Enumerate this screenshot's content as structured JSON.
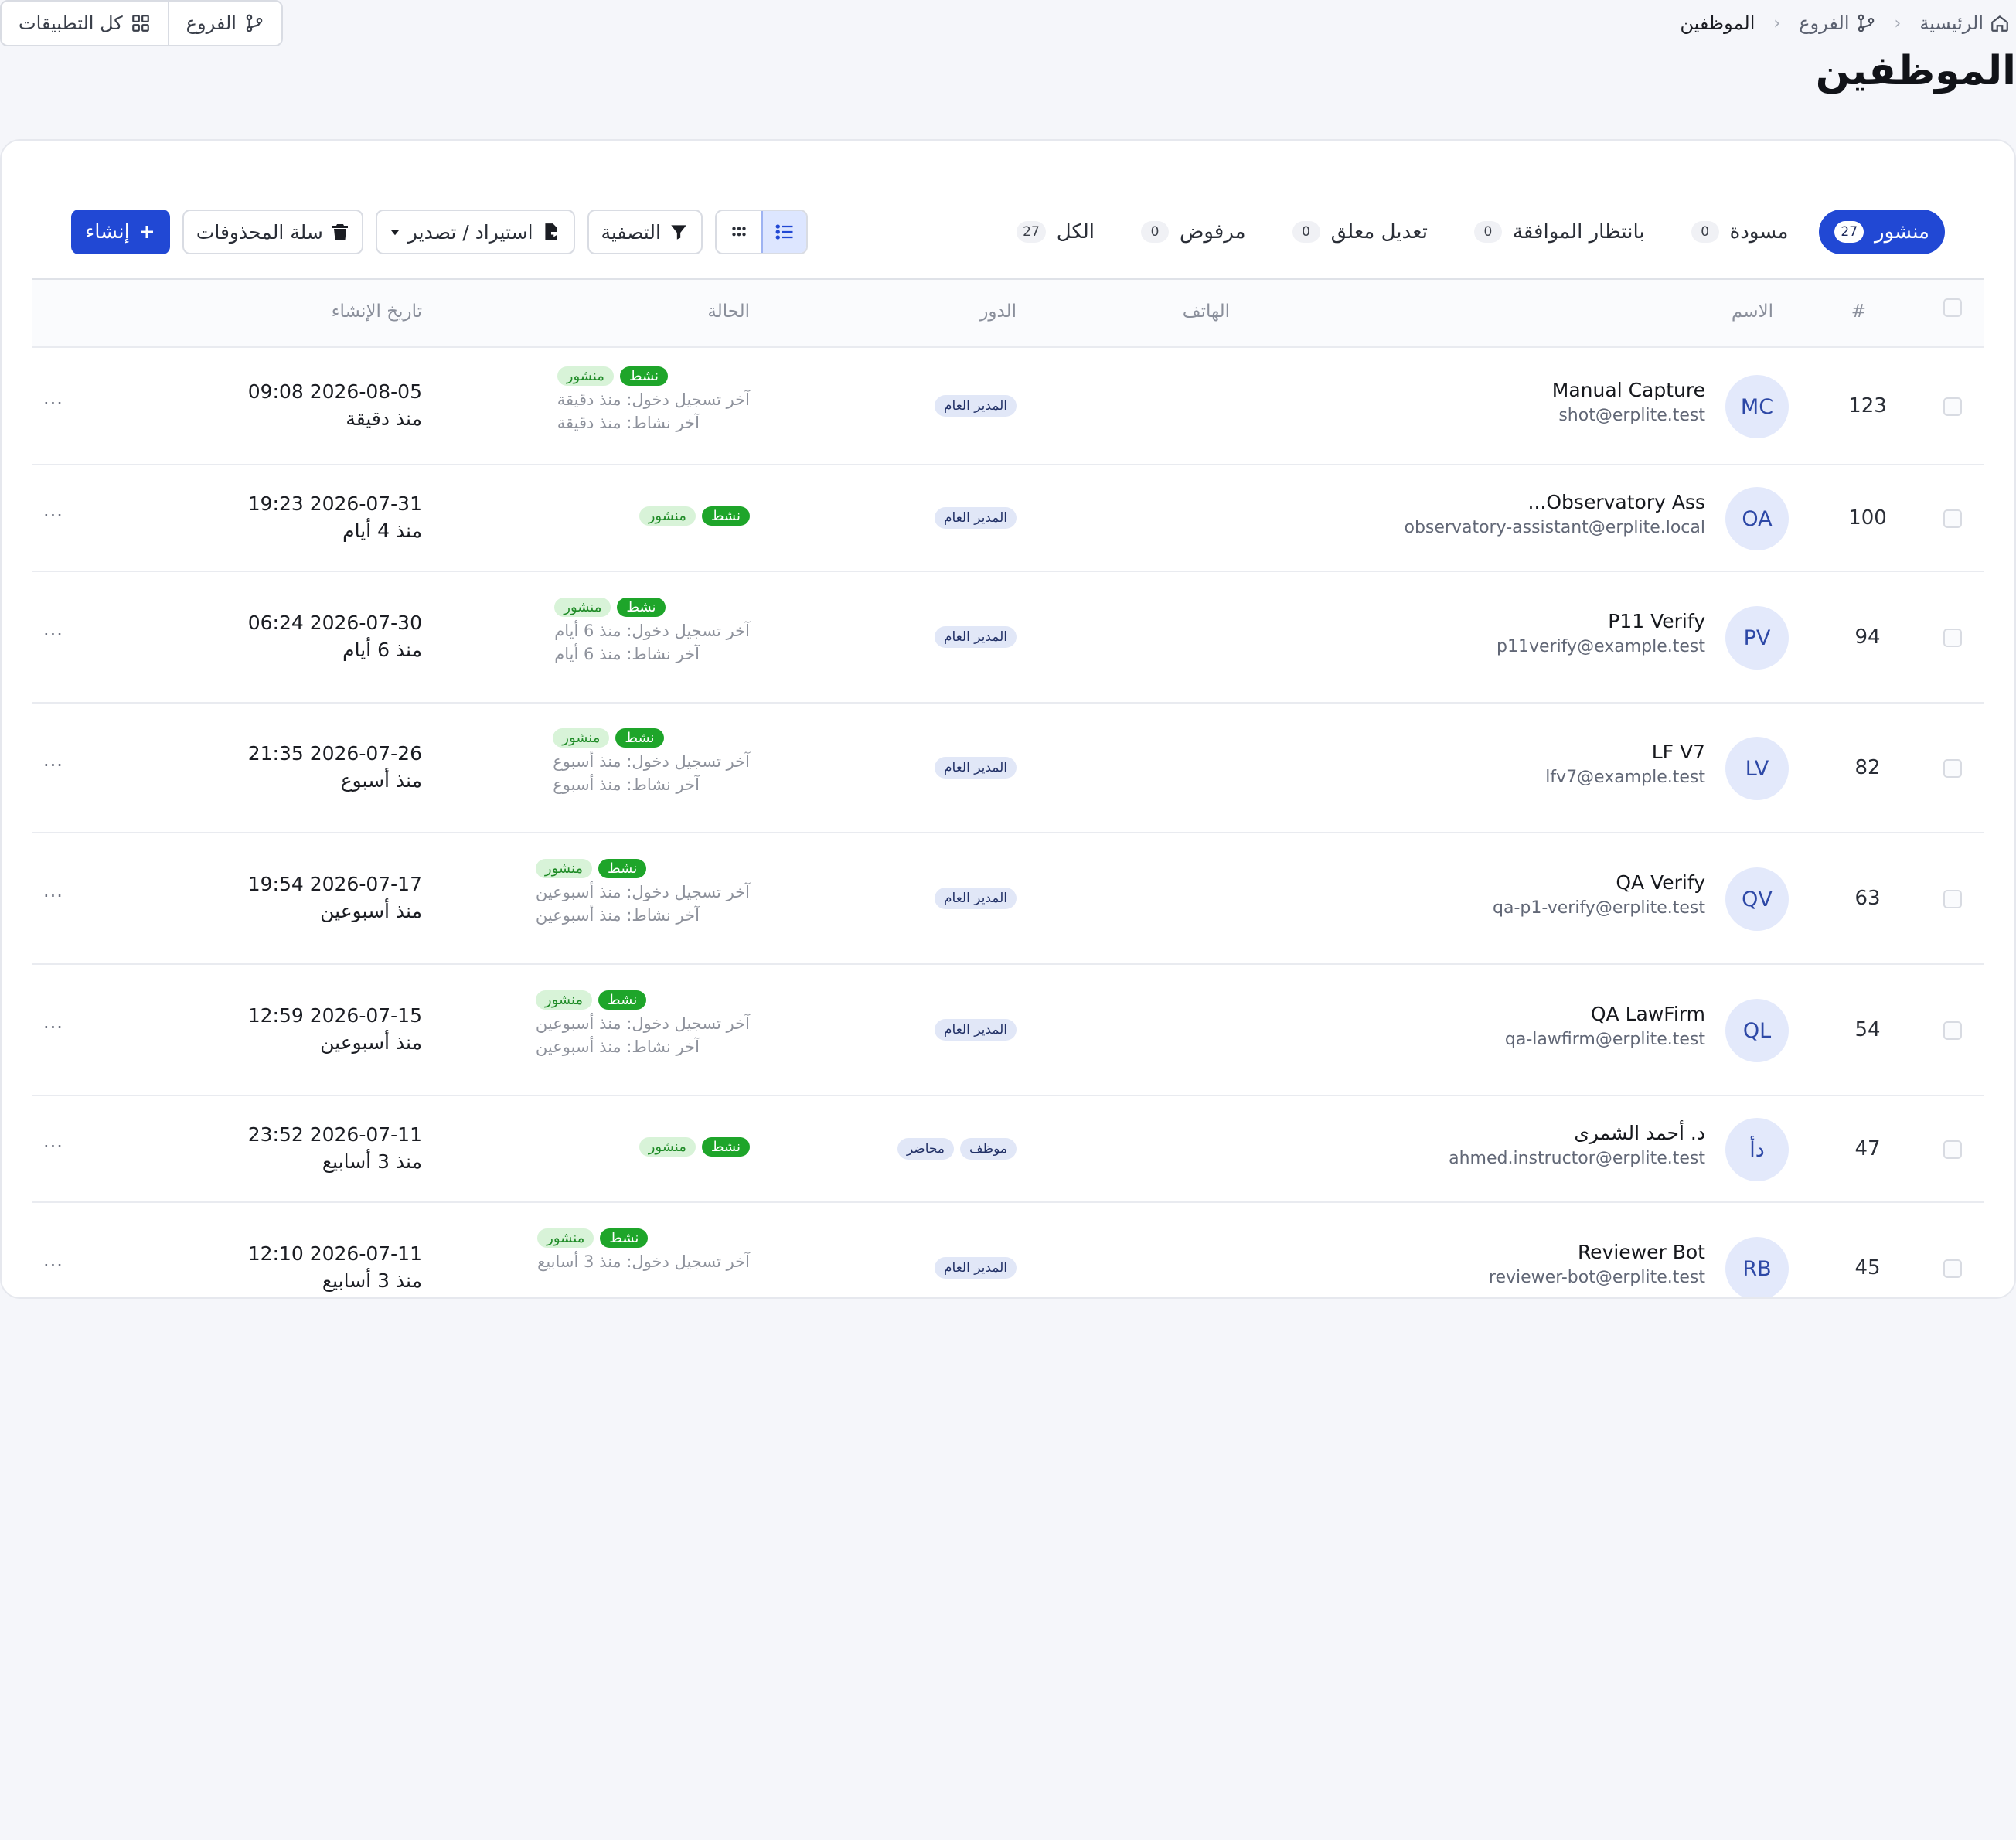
{
  "breadcrumb": {
    "home": "الرئيسية",
    "branches": "الفروع",
    "current": "الموظفين"
  },
  "top_buttons": {
    "all_apps": "كل التطبيقات",
    "branches": "الفروع"
  },
  "page_title": "الموظفين",
  "tabs": [
    {
      "label": "منشور",
      "count": "27"
    },
    {
      "label": "مسودة",
      "count": "0"
    },
    {
      "label": "بانتظار الموافقة",
      "count": "0"
    },
    {
      "label": "تعديل معلق",
      "count": "0"
    },
    {
      "label": "مرفوض",
      "count": "0"
    },
    {
      "label": "الكل",
      "count": "27"
    }
  ],
  "actions": {
    "filter": "التصفية",
    "import_export": "استيراد / تصدير",
    "trash": "سلة المحذوفات",
    "create": "إنشاء"
  },
  "columns": {
    "num": "#",
    "name": "الاسم",
    "phone": "الهاتف",
    "role": "الدور",
    "status": "الحالة",
    "created": "تاريخ الإنشاء"
  },
  "rows": [
    {
      "id": "123",
      "initials": "MC",
      "name": "Manual Capture",
      "email": "shot@erplite.test",
      "roles": [
        "المدير العام"
      ],
      "status_active": "نشط",
      "status_pub": "منشور",
      "last_login": "آخر تسجيل دخول: منذ دقيقة",
      "last_activity": "آخر نشاط: منذ دقيقة",
      "date": "2026-08-05 09:08",
      "relative": "منذ دقيقة"
    },
    {
      "id": "100",
      "initials": "OA",
      "name": "Observatory Ass...",
      "email": "observatory-assistant@erplite.local",
      "roles": [
        "المدير العام"
      ],
      "status_active": "نشط",
      "status_pub": "منشور",
      "last_login": "",
      "last_activity": "",
      "date": "2026-07-31 19:23",
      "relative": "منذ 4 أيام"
    },
    {
      "id": "94",
      "initials": "PV",
      "name": "P11 Verify",
      "email": "p11verify@example.test",
      "roles": [
        "المدير العام"
      ],
      "status_active": "نشط",
      "status_pub": "منشور",
      "last_login": "آخر تسجيل دخول: منذ 6 أيام",
      "last_activity": "آخر نشاط: منذ 6 أيام",
      "date": "2026-07-30 06:24",
      "relative": "منذ 6 أيام"
    },
    {
      "id": "82",
      "initials": "LV",
      "name": "LF V7",
      "email": "lfv7@example.test",
      "roles": [
        "المدير العام"
      ],
      "status_active": "نشط",
      "status_pub": "منشور",
      "last_login": "آخر تسجيل دخول: منذ أسبوع",
      "last_activity": "آخر نشاط: منذ أسبوع",
      "date": "2026-07-26 21:35",
      "relative": "منذ أسبوع"
    },
    {
      "id": "63",
      "initials": "QV",
      "name": "QA Verify",
      "email": "qa-p1-verify@erplite.test",
      "roles": [
        "المدير العام"
      ],
      "status_active": "نشط",
      "status_pub": "منشور",
      "last_login": "آخر تسجيل دخول: منذ أسبوعين",
      "last_activity": "آخر نشاط: منذ أسبوعين",
      "date": "2026-07-17 19:54",
      "relative": "منذ أسبوعين"
    },
    {
      "id": "54",
      "initials": "QL",
      "name": "QA LawFirm",
      "email": "qa-lawfirm@erplite.test",
      "roles": [
        "المدير العام"
      ],
      "status_active": "نشط",
      "status_pub": "منشور",
      "last_login": "آخر تسجيل دخول: منذ أسبوعين",
      "last_activity": "آخر نشاط: منذ أسبوعين",
      "date": "2026-07-15 12:59",
      "relative": "منذ أسبوعين"
    },
    {
      "id": "47",
      "initials": "دأ",
      "name": "د. أحمد الشمرى",
      "email": "ahmed.instructor@erplite.test",
      "roles": [
        "موظف",
        "محاضر"
      ],
      "status_active": "نشط",
      "status_pub": "منشور",
      "last_login": "",
      "last_activity": "",
      "date": "2026-07-11 23:52",
      "relative": "منذ 3 أسابيع"
    },
    {
      "id": "45",
      "initials": "RB",
      "name": "Reviewer Bot",
      "email": "reviewer-bot@erplite.test",
      "roles": [
        "المدير العام"
      ],
      "status_active": "نشط",
      "status_pub": "منشور",
      "last_login": "آخر تسجيل دخول: منذ 3 أسابيع",
      "last_activity": "",
      "date": "2026-07-11 12:10",
      "relative": "منذ 3 أسابيع"
    }
  ],
  "row_menu": "···",
  "colors": {
    "primary": "#2148d4",
    "success": "#1ea52a",
    "background": "#f5f6fa"
  },
  "icons": [
    "home-icon",
    "branch-icon",
    "grid-icon",
    "filter-icon",
    "file-export-icon",
    "trash-icon",
    "plus-icon",
    "list-view-icon",
    "grid-view-icon",
    "caret-down-icon"
  ]
}
